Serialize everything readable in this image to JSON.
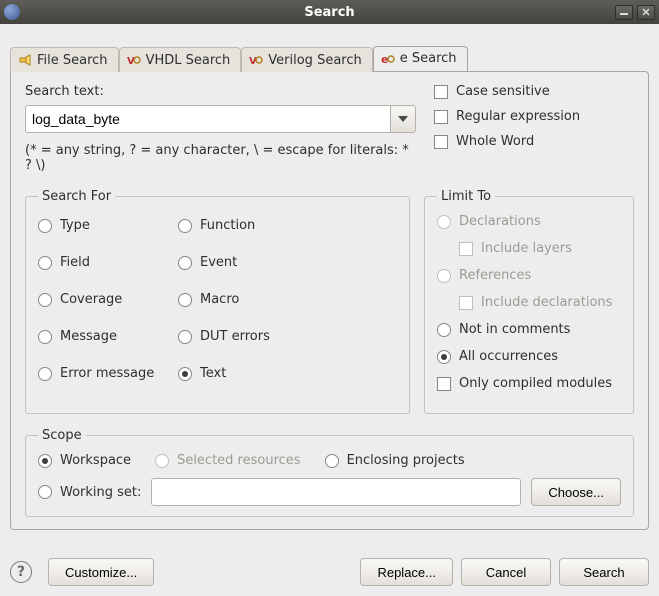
{
  "window": {
    "title": "Search"
  },
  "tabs": [
    {
      "label": "File Search"
    },
    {
      "label": "VHDL Search"
    },
    {
      "label": "Verilog Search"
    },
    {
      "label": "e Search"
    }
  ],
  "search_text": {
    "label": "Search text:",
    "value": "log_data_byte",
    "hint": "(* = any string, ? = any character, \\ = escape for literals: * ? \\)"
  },
  "options": {
    "case_sensitive": "Case sensitive",
    "regex": "Regular expression",
    "whole_word": "Whole Word"
  },
  "search_for": {
    "legend": "Search For",
    "items": {
      "type": "Type",
      "function": "Function",
      "field": "Field",
      "event": "Event",
      "coverage": "Coverage",
      "macro": "Macro",
      "message": "Message",
      "dut_errors": "DUT errors",
      "error_message": "Error message",
      "text": "Text"
    }
  },
  "limit_to": {
    "legend": "Limit To",
    "declarations": "Declarations",
    "include_layers": "Include layers",
    "references": "References",
    "include_declarations": "Include declarations",
    "not_in_comments": "Not in comments",
    "all_occurrences": "All occurrences",
    "only_compiled": "Only compiled modules"
  },
  "scope": {
    "legend": "Scope",
    "workspace": "Workspace",
    "selected_resources": "Selected resources",
    "enclosing_projects": "Enclosing projects",
    "working_set": "Working set:",
    "working_set_value": "",
    "choose": "Choose..."
  },
  "buttons": {
    "customize": "Customize...",
    "replace": "Replace...",
    "cancel": "Cancel",
    "search": "Search"
  }
}
